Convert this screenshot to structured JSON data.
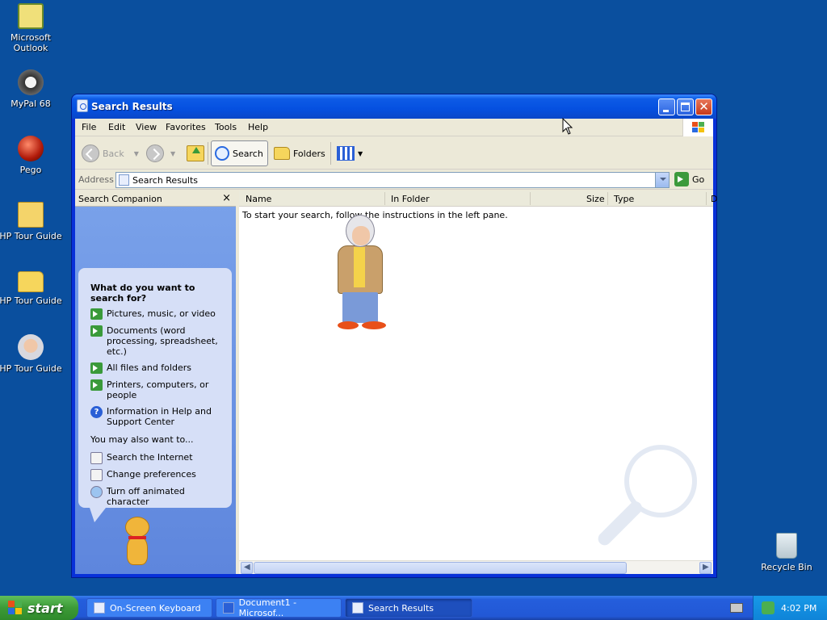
{
  "desktop": {
    "icons": [
      {
        "label": "Microsoft Outlook",
        "icon": "outlook-icon"
      },
      {
        "label": "MyPal 68",
        "icon": "raccoon-icon"
      },
      {
        "label": "Pego",
        "icon": "pego-icon"
      },
      {
        "label": "HP Tour Guide",
        "icon": "zip-folder-icon"
      },
      {
        "label": "HP Tour Guide",
        "icon": "folder-icon"
      },
      {
        "label": "HP Tour Guide",
        "icon": "guide-character-icon"
      },
      {
        "label": "Recycle Bin",
        "icon": "recycle-bin-icon"
      }
    ]
  },
  "window": {
    "title": "Search Results",
    "menu": [
      "File",
      "Edit",
      "View",
      "Favorites",
      "Tools",
      "Help"
    ],
    "toolbar": {
      "back": "Back",
      "search": "Search",
      "folders": "Folders"
    },
    "address": {
      "label": "Address",
      "value": "Search Results",
      "go": "Go"
    },
    "companion": {
      "title": "Search Companion",
      "close": "×",
      "question": "What do you want to search for?",
      "options": [
        "Pictures, music, or video",
        "Documents (word processing, spreadsheet, etc.)",
        "All files and folders",
        "Printers, computers, or people",
        "Information in Help and Support Center"
      ],
      "also_heading": "You may also want to...",
      "also": [
        "Search the Internet",
        "Change preferences",
        "Turn off animated character"
      ]
    },
    "results": {
      "columns": [
        "Name",
        "In Folder",
        "Size",
        "Type",
        "D"
      ],
      "instructions": "To start your search, follow the instructions in the left pane."
    }
  },
  "taskbar": {
    "start": "start",
    "tasks": [
      "On-Screen Keyboard",
      "Document1 - Microsof...",
      "Search Results"
    ],
    "clock": "4:02 PM"
  },
  "colors": {
    "desktop": "#0a4f9e",
    "titlebar": "#0550e0",
    "start": "#3c9a37",
    "taskbar": "#2258d6"
  }
}
